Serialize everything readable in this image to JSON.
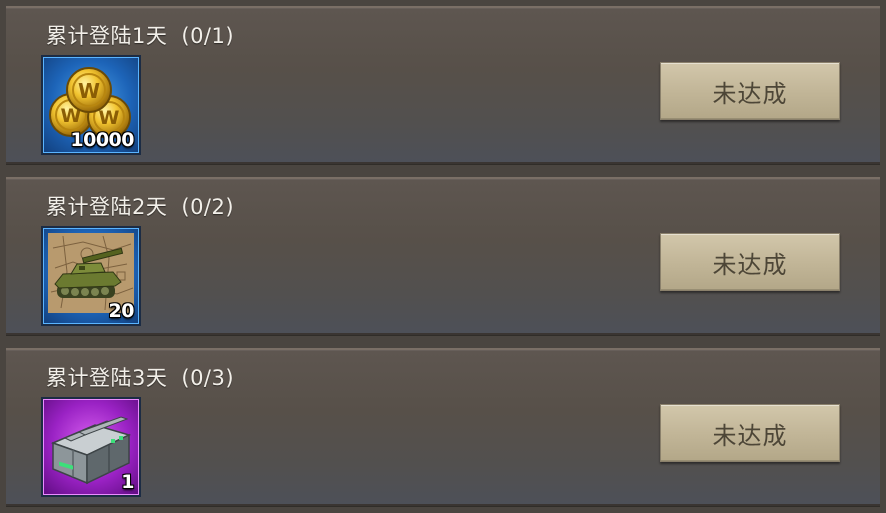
{
  "rewards": [
    {
      "title": "累计登陆1天",
      "progress": "(0/1)",
      "item_icon": "gold-coins-icon",
      "quantity": "10000",
      "rarity_color": "#1d64b8",
      "status": "未达成"
    },
    {
      "title": "累计登陆2天",
      "progress": "(0/2)",
      "item_icon": "tank-blueprint-icon",
      "quantity": "20",
      "rarity_color": "#1d64b8",
      "status": "未达成"
    },
    {
      "title": "累计登陆3天",
      "progress": "(0/3)",
      "item_icon": "supply-crate-icon",
      "quantity": "1",
      "rarity_color": "#9a22c4",
      "status": "未达成"
    }
  ]
}
